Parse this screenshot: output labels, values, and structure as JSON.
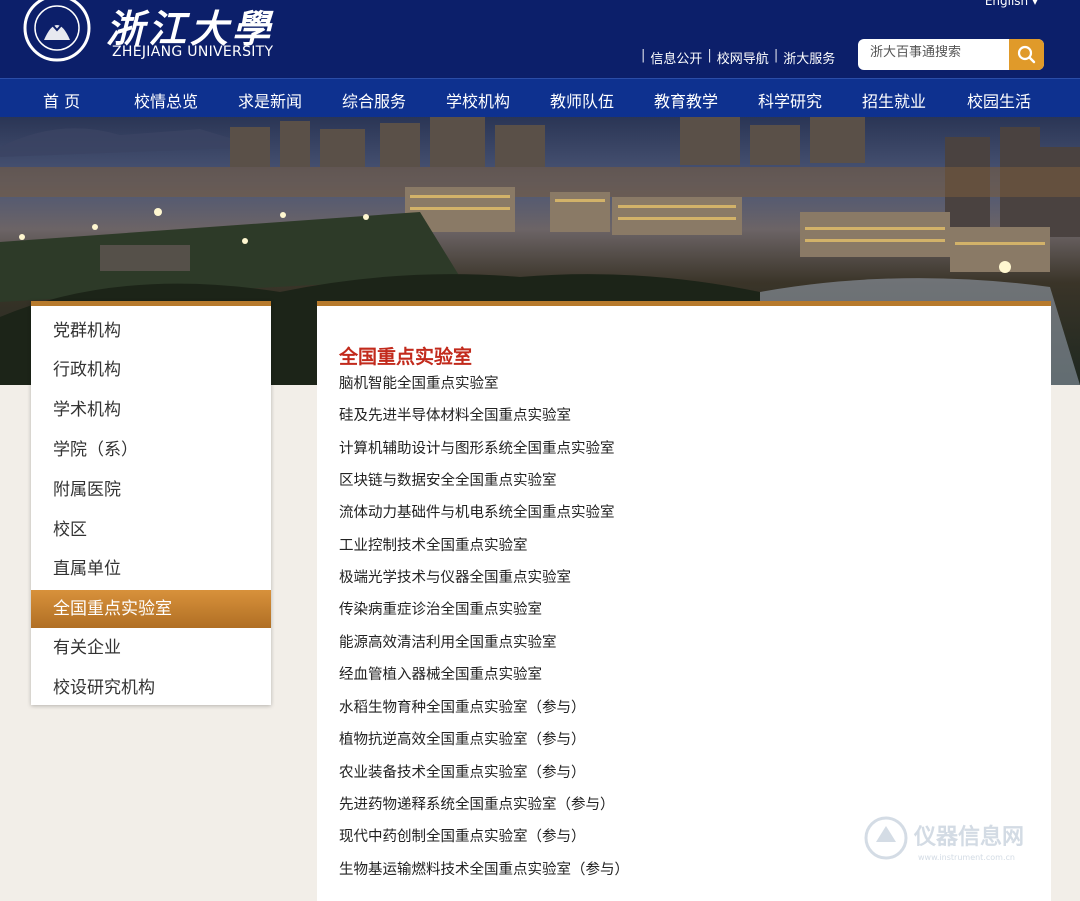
{
  "header": {
    "logo_cn": "浙江大學",
    "logo_en": "ZHEJIANG UNIVERSITY",
    "language_link": "English",
    "quick_links": [
      "信息公开",
      "校网导航",
      "浙大服务"
    ],
    "search_placeholder": "浙大百事通搜索"
  },
  "nav": {
    "items": [
      "首 页",
      "校情总览",
      "求是新闻",
      "综合服务",
      "学校机构",
      "教师队伍",
      "教育教学",
      "科学研究",
      "招生就业",
      "校园生活"
    ]
  },
  "sidebar": {
    "items": [
      "党群机构",
      "行政机构",
      "学术机构",
      "学院（系）",
      "附属医院",
      "校区",
      "直属单位",
      "全国重点实验室",
      "有关企业",
      "校设研究机构"
    ],
    "active_index": 7
  },
  "content": {
    "title": "全国重点实验室",
    "labs": [
      "脑机智能全国重点实验室",
      "硅及先进半导体材料全国重点实验室",
      "计算机辅助设计与图形系统全国重点实验室",
      "区块链与数据安全全国重点实验室",
      "流体动力基础件与机电系统全国重点实验室",
      "工业控制技术全国重点实验室",
      "极端光学技术与仪器全国重点实验室",
      "传染病重症诊治全国重点实验室",
      "能源高效清洁利用全国重点实验室",
      "经血管植入器械全国重点实验室",
      "水稻生物育种全国重点实验室（参与）",
      "植物抗逆高效全国重点实验室（参与）",
      "农业装备技术全国重点实验室（参与）",
      "先进药物递释系统全国重点实验室（参与）",
      "现代中药创制全国重点实验室（参与）",
      "生物基运输燃料技术全国重点实验室（参与）"
    ]
  },
  "watermark": {
    "text": "仪器信息网",
    "url": "www.instrument.com.cn"
  },
  "colors": {
    "header_bg": "#0c1f6a",
    "nav_bg": "#0e318f",
    "accent_orange": "#b77a2c",
    "search_button": "#e09a2a",
    "title_red": "#c22a1c",
    "page_bg": "#f2eee8"
  }
}
